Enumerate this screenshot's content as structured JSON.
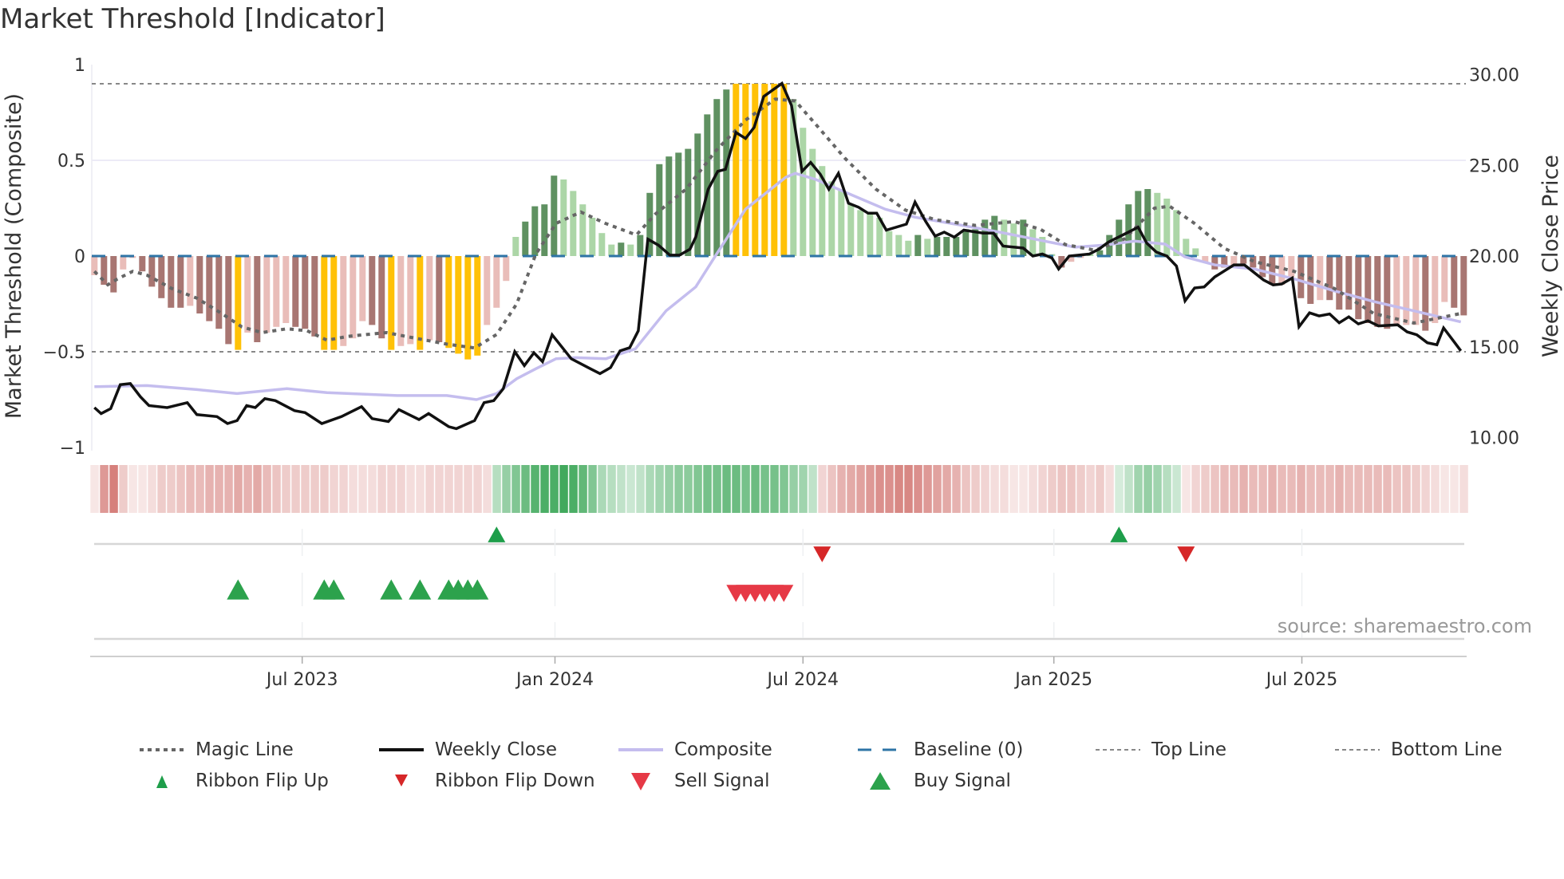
{
  "title": "Market Threshold [Indicator]",
  "source": "source: sharemaestro.com",
  "chart_data": {
    "type": "bar",
    "title": "Market Threshold [Indicator]",
    "ylabel_left": "Market Threshold (Composite)",
    "ylabel_right": "Weekly Close Price",
    "ylim_left": [
      -1,
      1
    ],
    "ylim_right": [
      10,
      30
    ],
    "left_ticks": [
      {
        "v": 1,
        "label": "1"
      },
      {
        "v": 0.5,
        "label": "0.5"
      },
      {
        "v": 0,
        "label": "0"
      },
      {
        "v": -0.5,
        "label": "−0.5"
      },
      {
        "v": -1,
        "label": "−1"
      }
    ],
    "right_ticks": [
      {
        "v": 30,
        "label": "30.00"
      },
      {
        "v": 25,
        "label": "25.00"
      },
      {
        "v": 20,
        "label": "20.00"
      },
      {
        "v": 15,
        "label": "15.00"
      },
      {
        "v": 10,
        "label": "10.00"
      }
    ],
    "x_ticks": [
      {
        "week": 21.7,
        "label": "Jul 2023"
      },
      {
        "week": 48.1,
        "label": "Jan 2024"
      },
      {
        "week": 74.0,
        "label": "Jul 2024"
      },
      {
        "week": 100.2,
        "label": "Jan 2025"
      },
      {
        "week": 126.1,
        "label": "Jul 2025"
      }
    ],
    "top_line": 0.9,
    "bottom_line": -0.5,
    "baseline": 0,
    "bar_tone_legend": {
      "-2": "strong negative",
      "-1": "weak negative",
      "0": "extreme",
      "1": "weak positive",
      "2": "strong positive"
    },
    "bars": [
      -0.1,
      -0.15,
      -0.19,
      -0.07,
      -0.01,
      -0.08,
      -0.16,
      -0.22,
      -0.27,
      -0.27,
      -0.26,
      -0.3,
      -0.34,
      -0.38,
      -0.46,
      -0.49,
      -0.4,
      -0.45,
      -0.4,
      -0.37,
      -0.35,
      -0.37,
      -0.38,
      -0.42,
      -0.49,
      -0.49,
      -0.47,
      -0.43,
      -0.34,
      -0.36,
      -0.43,
      -0.49,
      -0.47,
      -0.46,
      -0.49,
      -0.44,
      -0.45,
      -0.48,
      -0.51,
      -0.54,
      -0.52,
      -0.36,
      -0.27,
      -0.13,
      0.1,
      0.18,
      0.26,
      0.27,
      0.42,
      0.4,
      0.34,
      0.27,
      0.2,
      0.12,
      0.06,
      0.07,
      0.06,
      0.11,
      0.33,
      0.48,
      0.52,
      0.54,
      0.56,
      0.64,
      0.74,
      0.82,
      0.87,
      0.9,
      0.9,
      0.9,
      0.9,
      0.9,
      0.9,
      0.82,
      0.67,
      0.56,
      0.47,
      0.39,
      0.35,
      0.27,
      0.24,
      0.22,
      0.2,
      0.13,
      0.11,
      0.08,
      0.11,
      0.09,
      0.1,
      0.1,
      0.1,
      0.14,
      0.14,
      0.19,
      0.21,
      0.19,
      0.17,
      0.19,
      0.14,
      0.1,
      0.01,
      -0.06,
      -0.03,
      -0.01,
      0.01,
      0.03,
      0.11,
      0.19,
      0.27,
      0.34,
      0.35,
      0.33,
      0.3,
      0.24,
      0.09,
      0.04,
      -0.03,
      -0.07,
      -0.06,
      -0.05,
      -0.04,
      -0.06,
      -0.11,
      -0.15,
      -0.15,
      -0.11,
      -0.22,
      -0.25,
      -0.23,
      -0.23,
      -0.28,
      -0.28,
      -0.33,
      -0.35,
      -0.37,
      -0.38,
      -0.36,
      -0.36,
      -0.36,
      -0.39,
      -0.35,
      -0.24,
      -0.27,
      -0.31
    ],
    "bar_tones": [
      -1,
      -2,
      -2,
      -1,
      -1,
      -2,
      -2,
      -2,
      -2,
      -2,
      -1,
      -2,
      -2,
      -2,
      -2,
      0,
      -1,
      -2,
      -1,
      -1,
      -1,
      -2,
      -2,
      -2,
      0,
      0,
      -1,
      -1,
      -1,
      -2,
      -2,
      0,
      -1,
      -1,
      0,
      -1,
      -2,
      0,
      0,
      0,
      0,
      -1,
      -1,
      -1,
      1,
      2,
      2,
      2,
      2,
      1,
      1,
      1,
      1,
      1,
      1,
      2,
      1,
      2,
      2,
      2,
      2,
      2,
      2,
      2,
      2,
      2,
      2,
      0,
      0,
      0,
      0,
      0,
      0,
      1,
      1,
      1,
      1,
      1,
      1,
      1,
      1,
      1,
      1,
      1,
      1,
      1,
      2,
      1,
      2,
      2,
      2,
      2,
      2,
      2,
      2,
      1,
      1,
      2,
      1,
      1,
      1,
      -2,
      -1,
      -1,
      1,
      2,
      2,
      2,
      2,
      2,
      2,
      1,
      1,
      1,
      1,
      1,
      -1,
      -2,
      -2,
      -1,
      -2,
      -2,
      -2,
      -2,
      -1,
      -1,
      -2,
      -2,
      -1,
      -2,
      -2,
      -2,
      -2,
      -2,
      -2,
      -2,
      -1,
      -1,
      -1,
      -2,
      -1,
      -1,
      -2,
      -2
    ],
    "ribbon": [
      -0.15,
      -0.6,
      -0.75,
      -0.3,
      -0.15,
      -0.15,
      -0.2,
      -0.3,
      -0.3,
      -0.35,
      -0.4,
      -0.4,
      -0.45,
      -0.45,
      -0.45,
      -0.5,
      -0.45,
      -0.5,
      -0.4,
      -0.35,
      -0.3,
      -0.3,
      -0.3,
      -0.3,
      -0.3,
      -0.25,
      -0.25,
      -0.2,
      -0.2,
      -0.2,
      -0.25,
      -0.25,
      -0.25,
      -0.2,
      -0.2,
      -0.25,
      -0.25,
      -0.25,
      -0.25,
      -0.25,
      -0.25,
      -0.2,
      0.35,
      0.5,
      0.6,
      0.7,
      0.8,
      0.85,
      0.85,
      0.9,
      0.85,
      0.75,
      0.6,
      0.4,
      0.35,
      0.3,
      0.25,
      0.3,
      0.4,
      0.45,
      0.5,
      0.55,
      0.55,
      0.6,
      0.65,
      0.65,
      0.7,
      0.7,
      0.65,
      0.7,
      0.65,
      0.65,
      0.6,
      0.5,
      0.45,
      0.3,
      -0.25,
      -0.35,
      -0.45,
      -0.5,
      -0.55,
      -0.6,
      -0.65,
      -0.65,
      -0.7,
      -0.7,
      -0.65,
      -0.6,
      -0.55,
      -0.5,
      -0.45,
      -0.35,
      -0.3,
      -0.25,
      -0.2,
      -0.2,
      -0.15,
      -0.15,
      -0.2,
      -0.25,
      -0.3,
      -0.35,
      -0.35,
      -0.3,
      -0.25,
      -0.3,
      -0.2,
      0.2,
      0.3,
      0.45,
      0.5,
      0.45,
      0.35,
      0.25,
      -0.15,
      -0.25,
      -0.3,
      -0.35,
      -0.4,
      -0.4,
      -0.45,
      -0.4,
      -0.4,
      -0.45,
      -0.4,
      -0.4,
      -0.45,
      -0.4,
      -0.4,
      -0.4,
      -0.45,
      -0.4,
      -0.4,
      -0.4,
      -0.4,
      -0.4,
      -0.35,
      -0.35,
      -0.3,
      -0.25,
      -0.2,
      -0.15,
      -0.15,
      -0.2
    ],
    "weekly_close": [
      [
        0,
        11.65
      ],
      [
        0.7,
        11.32
      ],
      [
        1.7,
        11.59
      ],
      [
        2.7,
        12.91
      ],
      [
        3.75,
        12.97
      ],
      [
        4.8,
        12.25
      ],
      [
        5.7,
        11.76
      ],
      [
        7.6,
        11.65
      ],
      [
        9.7,
        11.92
      ],
      [
        10.7,
        11.26
      ],
      [
        12.8,
        11.15
      ],
      [
        13.9,
        10.77
      ],
      [
        14.9,
        10.93
      ],
      [
        15.9,
        11.76
      ],
      [
        16.8,
        11.65
      ],
      [
        17.8,
        12.14
      ],
      [
        18.9,
        12.03
      ],
      [
        20.9,
        11.48
      ],
      [
        22,
        11.37
      ],
      [
        23.75,
        10.77
      ],
      [
        25.8,
        11.15
      ],
      [
        27.9,
        11.7
      ],
      [
        29,
        11.04
      ],
      [
        30.7,
        10.88
      ],
      [
        31.8,
        11.54
      ],
      [
        33.9,
        10.99
      ],
      [
        34.9,
        11.32
      ],
      [
        37,
        10.6
      ],
      [
        37.8,
        10.49
      ],
      [
        39.7,
        10.93
      ],
      [
        40.7,
        11.92
      ],
      [
        41.7,
        12.03
      ],
      [
        42.7,
        12.69
      ],
      [
        43.9,
        14.73
      ],
      [
        44.9,
        13.96
      ],
      [
        45.9,
        14.67
      ],
      [
        46.8,
        14.18
      ],
      [
        47.8,
        15.66
      ],
      [
        49.8,
        14.34
      ],
      [
        51.8,
        13.79
      ],
      [
        52.8,
        13.52
      ],
      [
        53.9,
        13.85
      ],
      [
        54.9,
        14.78
      ],
      [
        55.9,
        14.95
      ],
      [
        56.8,
        15.88
      ],
      [
        57.8,
        20.93
      ],
      [
        58.9,
        20.6
      ],
      [
        60.1,
        20.05
      ],
      [
        61.1,
        20.05
      ],
      [
        62.2,
        20.38
      ],
      [
        62.8,
        21.04
      ],
      [
        64.1,
        23.68
      ],
      [
        65.1,
        24.67
      ],
      [
        65.9,
        24.78
      ],
      [
        67,
        26.81
      ],
      [
        68,
        26.48
      ],
      [
        68.9,
        27.09
      ],
      [
        69.9,
        28.79
      ],
      [
        71.8,
        29.51
      ],
      [
        72.8,
        28.3
      ],
      [
        73.9,
        24.67
      ],
      [
        74.8,
        25.16
      ],
      [
        75.8,
        24.51
      ],
      [
        76.7,
        23.68
      ],
      [
        77.7,
        24.56
      ],
      [
        78.75,
        22.91
      ],
      [
        79.8,
        22.69
      ],
      [
        80.8,
        22.36
      ],
      [
        81.7,
        22.36
      ],
      [
        82.7,
        21.43
      ],
      [
        84.8,
        21.76
      ],
      [
        85.7,
        22.97
      ],
      [
        86.8,
        21.92
      ],
      [
        87.8,
        21.1
      ],
      [
        88.75,
        21.32
      ],
      [
        89.8,
        21.04
      ],
      [
        90.8,
        21.43
      ],
      [
        92.8,
        21.26
      ],
      [
        93.9,
        21.26
      ],
      [
        94.9,
        20.55
      ],
      [
        97,
        20.44
      ],
      [
        98,
        20.0
      ],
      [
        99,
        20.11
      ],
      [
        100,
        19.89
      ],
      [
        100.7,
        19.29
      ],
      [
        101.8,
        20.0
      ],
      [
        103.9,
        20.11
      ],
      [
        104.9,
        20.38
      ],
      [
        105.9,
        20.77
      ],
      [
        108,
        21.32
      ],
      [
        109,
        21.59
      ],
      [
        109.9,
        20.71
      ],
      [
        110.9,
        20.22
      ],
      [
        112,
        20.0
      ],
      [
        113,
        19.45
      ],
      [
        113.9,
        17.53
      ],
      [
        114.9,
        18.24
      ],
      [
        115.9,
        18.3
      ],
      [
        117,
        18.85
      ],
      [
        119,
        19.51
      ],
      [
        120.1,
        19.51
      ],
      [
        122.1,
        18.68
      ],
      [
        123.1,
        18.41
      ],
      [
        124,
        18.46
      ],
      [
        125.1,
        18.79
      ],
      [
        125.8,
        16.1
      ],
      [
        126.9,
        16.87
      ],
      [
        127.9,
        16.7
      ],
      [
        129,
        16.81
      ],
      [
        130,
        16.32
      ],
      [
        131,
        16.65
      ],
      [
        132,
        16.26
      ],
      [
        133,
        16.43
      ],
      [
        134.1,
        16.15
      ],
      [
        136.1,
        16.21
      ],
      [
        137.1,
        15.82
      ],
      [
        138.1,
        15.66
      ],
      [
        139.2,
        15.22
      ],
      [
        140.2,
        15.11
      ],
      [
        140.9,
        16.04
      ],
      [
        142,
        15.27
      ],
      [
        142.7,
        14.78
      ]
    ],
    "composite": [
      [
        0,
        12.8
      ],
      [
        5.5,
        12.86
      ],
      [
        10.7,
        12.64
      ],
      [
        14.9,
        12.42
      ],
      [
        20.1,
        12.69
      ],
      [
        24.3,
        12.47
      ],
      [
        31.6,
        12.31
      ],
      [
        36.8,
        12.31
      ],
      [
        39.9,
        12.09
      ],
      [
        42,
        12.42
      ],
      [
        44.1,
        13.24
      ],
      [
        46.1,
        13.79
      ],
      [
        48.2,
        14.34
      ],
      [
        50.3,
        14.4
      ],
      [
        53.4,
        14.34
      ],
      [
        56.5,
        14.89
      ],
      [
        59.7,
        16.98
      ],
      [
        62.8,
        18.3
      ],
      [
        64.9,
        20.05
      ],
      [
        68,
        22.58
      ],
      [
        72.2,
        24.34
      ],
      [
        73.2,
        24.56
      ],
      [
        75.3,
        24.23
      ],
      [
        78.4,
        23.52
      ],
      [
        82.6,
        22.58
      ],
      [
        85.7,
        22.14
      ],
      [
        89.9,
        21.76
      ],
      [
        94,
        21.37
      ],
      [
        98.2,
        20.93
      ],
      [
        102.4,
        20.49
      ],
      [
        105.5,
        20.6
      ],
      [
        108.6,
        20.82
      ],
      [
        111.8,
        20.66
      ],
      [
        113.9,
        19.95
      ],
      [
        117,
        19.51
      ],
      [
        121.1,
        19.29
      ],
      [
        125.3,
        18.74
      ],
      [
        129.5,
        18.08
      ],
      [
        133.7,
        17.48
      ],
      [
        137.8,
        16.98
      ],
      [
        142.7,
        16.37
      ]
    ],
    "magic_line": [
      [
        0,
        -0.08
      ],
      [
        1.4,
        -0.15
      ],
      [
        2.4,
        -0.12
      ],
      [
        4,
        -0.08
      ],
      [
        5.5,
        -0.1
      ],
      [
        8.1,
        -0.17
      ],
      [
        10.7,
        -0.22
      ],
      [
        13.3,
        -0.3
      ],
      [
        15.4,
        -0.37
      ],
      [
        17.5,
        -0.4
      ],
      [
        20.1,
        -0.38
      ],
      [
        22.2,
        -0.39
      ],
      [
        24.3,
        -0.44
      ],
      [
        26.4,
        -0.42
      ],
      [
        28.4,
        -0.41
      ],
      [
        30.5,
        -0.4
      ],
      [
        33.6,
        -0.43
      ],
      [
        36.8,
        -0.46
      ],
      [
        39.7,
        -0.48
      ],
      [
        42,
        -0.41
      ],
      [
        44.1,
        -0.25
      ],
      [
        46.1,
        0.01
      ],
      [
        48.2,
        0.17
      ],
      [
        50.8,
        0.23
      ],
      [
        53.4,
        0.17
      ],
      [
        56.6,
        0.11
      ],
      [
        58.6,
        0.22
      ],
      [
        61.8,
        0.35
      ],
      [
        64.9,
        0.55
      ],
      [
        68,
        0.71
      ],
      [
        71.1,
        0.82
      ],
      [
        73.2,
        0.81
      ],
      [
        75.3,
        0.69
      ],
      [
        78.4,
        0.51
      ],
      [
        81.6,
        0.35
      ],
      [
        84.7,
        0.24
      ],
      [
        87.8,
        0.19
      ],
      [
        92,
        0.16
      ],
      [
        96.1,
        0.18
      ],
      [
        98.8,
        0.14
      ],
      [
        101.4,
        0.06
      ],
      [
        104.5,
        0.03
      ],
      [
        107.6,
        0.09
      ],
      [
        110.7,
        0.25
      ],
      [
        112.3,
        0.26
      ],
      [
        114.9,
        0.17
      ],
      [
        118,
        0.04
      ],
      [
        121.2,
        -0.03
      ],
      [
        125.3,
        -0.08
      ],
      [
        129.5,
        -0.17
      ],
      [
        133.6,
        -0.3
      ],
      [
        137.8,
        -0.35
      ],
      [
        142.7,
        -0.3
      ]
    ],
    "ribbon_flip_up": [
      42,
      107
    ],
    "ribbon_flip_down": [
      76,
      114
    ],
    "buy_signals": [
      15,
      24,
      25,
      31,
      34,
      37,
      38,
      39,
      40
    ],
    "sell_signals": [
      67,
      68,
      69,
      70,
      71,
      72
    ],
    "legend": [
      {
        "label": "Magic Line",
        "kind": "dotted",
        "color": "#666666"
      },
      {
        "label": "Weekly Close",
        "kind": "solid",
        "color": "#111111"
      },
      {
        "label": "Composite",
        "kind": "solid",
        "color": "#c4bdee"
      },
      {
        "label": "Baseline (0)",
        "kind": "dashed",
        "color": "#2e74a6"
      },
      {
        "label": "Top Line",
        "kind": "thin-dotted",
        "color": "#888888"
      },
      {
        "label": "Bottom Line",
        "kind": "thin-dotted",
        "color": "#888888"
      },
      {
        "label": "Ribbon Flip Up",
        "kind": "tri-up-small",
        "color": "#1e9e4a"
      },
      {
        "label": "Ribbon Flip Down",
        "kind": "tri-down-small",
        "color": "#d62728"
      },
      {
        "label": "Sell Signal",
        "kind": "tri-down",
        "color": "#e63946"
      },
      {
        "label": "Buy Signal",
        "kind": "tri-up",
        "color": "#2ca24c"
      }
    ],
    "legend_placement": "bottom"
  },
  "colors": {
    "bar_dark_red": "#a87672",
    "bar_light_red": "#e9bdb9",
    "bar_yellow": "#ffc107",
    "bar_dark_green": "#5f9161",
    "bar_light_green": "#acd6a7"
  }
}
